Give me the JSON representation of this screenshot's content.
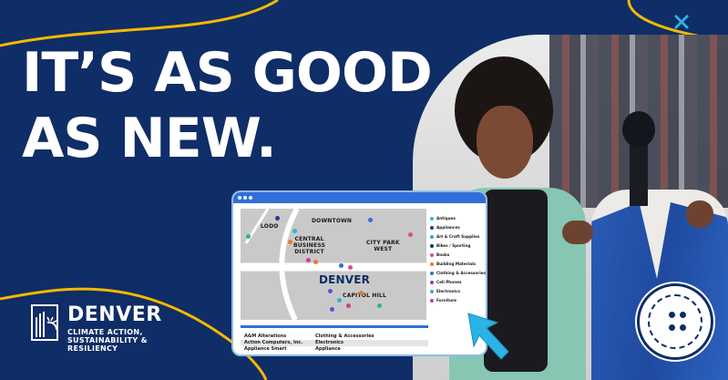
{
  "headline": {
    "line1": "IT’S AS GOOD",
    "line2": "AS NEW."
  },
  "colors": {
    "navy": "#0f2d66",
    "yellow": "#f5b800",
    "blue": "#2f6fd8",
    "white": "#ffffff"
  },
  "map": {
    "labels": {
      "lodo": "LODO",
      "downtown": "DOWNTOWN",
      "central": [
        "CENTRAL",
        "BUSINESS",
        "DISTRICT"
      ],
      "city_park": [
        "CITY PARK",
        "WEST"
      ],
      "denver": "DENVER",
      "capitol_hill": "CAPITOL HILL"
    },
    "legend": [
      {
        "label": "Antiques",
        "color": "#2ab3e6"
      },
      {
        "label": "Appliances",
        "color": "#1d3f8f"
      },
      {
        "label": "Art & Craft Supplies",
        "color": "#2fae9a"
      },
      {
        "label": "Bikes / Sporting",
        "color": "#1b2f6b"
      },
      {
        "label": "Books",
        "color": "#e04a8e"
      },
      {
        "label": "Building Materials",
        "color": "#e67a2f"
      },
      {
        "label": "Clothing & Accessories",
        "color": "#2f6fd8"
      },
      {
        "label": "Cell Phones",
        "color": "#7a45c8"
      },
      {
        "label": "Electronics",
        "color": "#3ea0e8"
      },
      {
        "label": "Furniture",
        "color": "#d63a8c"
      }
    ]
  },
  "listing": [
    {
      "name": "A&M Alterations",
      "category": "Clothing & Accessories"
    },
    {
      "name": "Action Computers, Inc.",
      "category": "Electronics"
    },
    {
      "name": "Appliance Smart",
      "category": "Appliance"
    }
  ],
  "logo": {
    "title": "DENVER",
    "subtitle": [
      "CLIMATE ACTION,",
      "SUSTAINABILITY &",
      "RESILIENCY"
    ]
  }
}
